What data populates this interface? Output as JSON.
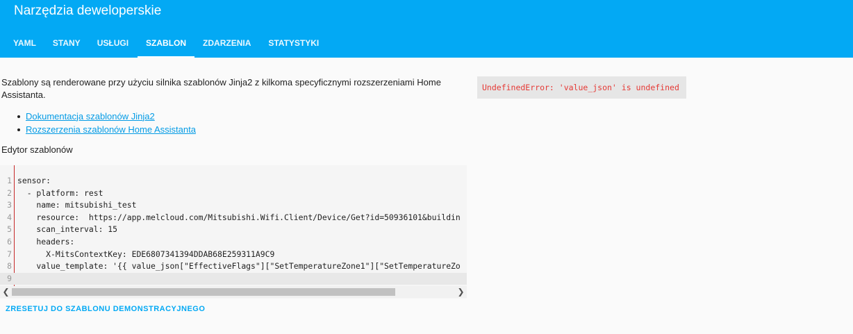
{
  "header": {
    "title": "Narzędzia deweloperskie",
    "accent_color": "#03a9f4"
  },
  "tabs": [
    {
      "label": "YAML",
      "active": false
    },
    {
      "label": "STANY",
      "active": false
    },
    {
      "label": "USŁUGI",
      "active": false
    },
    {
      "label": "SZABLON",
      "active": true
    },
    {
      "label": "ZDARZENIA",
      "active": false
    },
    {
      "label": "STATYSTYKI",
      "active": false
    }
  ],
  "intro": {
    "text": "Szablony są renderowane przy użyciu silnika szablonów Jinja2 z kilkoma specyficznymi rozszerzeniami Home Assistanta."
  },
  "links": [
    {
      "label": "Dokumentacja szablonów Jinja2"
    },
    {
      "label": "Rozszerzenia szablonów Home Assistanta"
    }
  ],
  "editor": {
    "label": "Edytor szablonów",
    "lines": [
      {
        "n": "1",
        "text": "sensor:"
      },
      {
        "n": "2",
        "text": "  - platform: rest"
      },
      {
        "n": "3",
        "text": "    name: mitsubishi_test"
      },
      {
        "n": "4",
        "text": "    resource:  https://app.melcloud.com/Mitsubishi.Wifi.Client/Device/Get?id=50936101&buildin"
      },
      {
        "n": "5",
        "text": "    scan_interval: 15"
      },
      {
        "n": "6",
        "text": "    headers:"
      },
      {
        "n": "7",
        "text": "      X-MitsContextKey: EDE6807341394DDAB68E259311A9C9"
      },
      {
        "n": "8",
        "text": "    value_template: '{{ value_json[\"EffectiveFlags\"][\"SetTemperatureZone1\"][\"SetTemperatureZo"
      },
      {
        "n": "9",
        "text": ""
      }
    ],
    "scroll_left_icon": "chevron-left-icon",
    "scroll_right_icon": "chevron-right-icon"
  },
  "reset_button": {
    "label": "ZRESETUJ DO SZABLONU DEMONSTRACYJNEGO"
  },
  "result": {
    "text": "UndefinedError: 'value_json' is undefined",
    "color": "#e53935"
  }
}
